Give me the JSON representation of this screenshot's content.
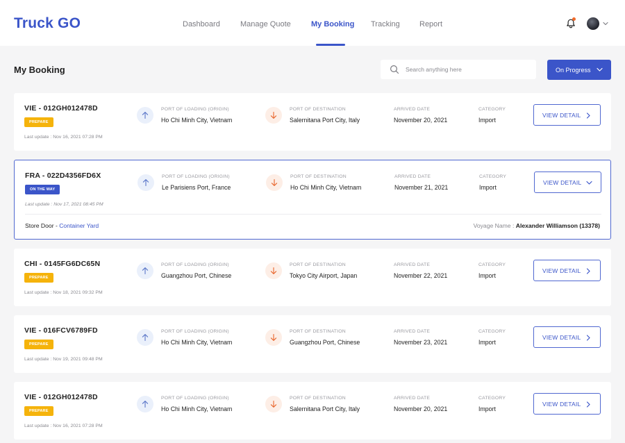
{
  "app": {
    "logo": "Truck GO"
  },
  "nav": {
    "items": [
      {
        "label": "Dashboard"
      },
      {
        "label": "Manage Quote"
      },
      {
        "label": "My Booking"
      },
      {
        "label": "Tracking"
      },
      {
        "label": "Report"
      }
    ],
    "active": "My Booking"
  },
  "header_icons": {
    "notification": "bell-icon",
    "notification_dot_color": "#f06a2a",
    "profile": "avatar",
    "menu": "chevron-down-icon"
  },
  "page": {
    "title": "My Booking"
  },
  "search": {
    "placeholder": "Search anything here"
  },
  "filter": {
    "label": "On Progress"
  },
  "fields": {
    "origin": "PORT OF LOADING (ORIGIN)",
    "destination": "PORT OF DESTINATION",
    "arrived": "ARRIVED DATE",
    "category": "CATEGORY",
    "view": "VIEW DETAIL"
  },
  "colors": {
    "accent": "#3b55c9",
    "prepare": "#f5b30b",
    "on_the_way": "#3b55c9",
    "origin_icon": "#5a76c8",
    "destination_icon": "#e8652b"
  },
  "bookings": [
    {
      "id": "VIE - 012GH012478D",
      "status": "PREPARE",
      "last_update": "Last update : Nov 16, 2021 07:28 PM",
      "origin": "Ho Chi Minh City, Vietnam",
      "destination": "Salernitana Port City, Italy",
      "arrived": "November 20, 2021",
      "category": "Import"
    },
    {
      "id": "FRA - 022D4356FD6X",
      "status": "ON THE WAY",
      "last_update": "Last update : Nov 17, 2021 08:45 PM",
      "origin": "Le Parisiens Port, France",
      "destination": "Ho Chi Minh City, Vietnam",
      "arrived": "November 21, 2021",
      "category": "Import",
      "expanded": true,
      "store_prefix": "Store Door - ",
      "store_link": "Container Yard",
      "voyage_label": "Voyage Name : ",
      "voyage_value": "Alexander Williamson (13378)"
    },
    {
      "id": "CHI - 0145FG6DC65N",
      "status": "PREPARE",
      "last_update": "Last update : Nov 18, 2021 09:32 PM",
      "origin": "Guangzhou Port, Chinese",
      "destination": "Tokyo City Airport, Japan",
      "arrived": "November 22, 2021",
      "category": "Import"
    },
    {
      "id": "VIE - 016FCV6789FD",
      "status": "PREPARE",
      "last_update": "Last update : Nov 19, 2021 09:48 PM",
      "origin": "Ho Chi Minh City, Vietnam",
      "destination": "Guangzhou Port, Chinese",
      "arrived": "November 23, 2021",
      "category": "Import"
    },
    {
      "id": "VIE - 012GH012478D",
      "status": "PREPARE",
      "last_update": "Last update : Nov 16, 2021 07:28 PM",
      "origin": "Ho Chi Minh City, Vietnam",
      "destination": "Salernitana Port City, Italy",
      "arrived": "November 20, 2021",
      "category": "Import"
    }
  ]
}
